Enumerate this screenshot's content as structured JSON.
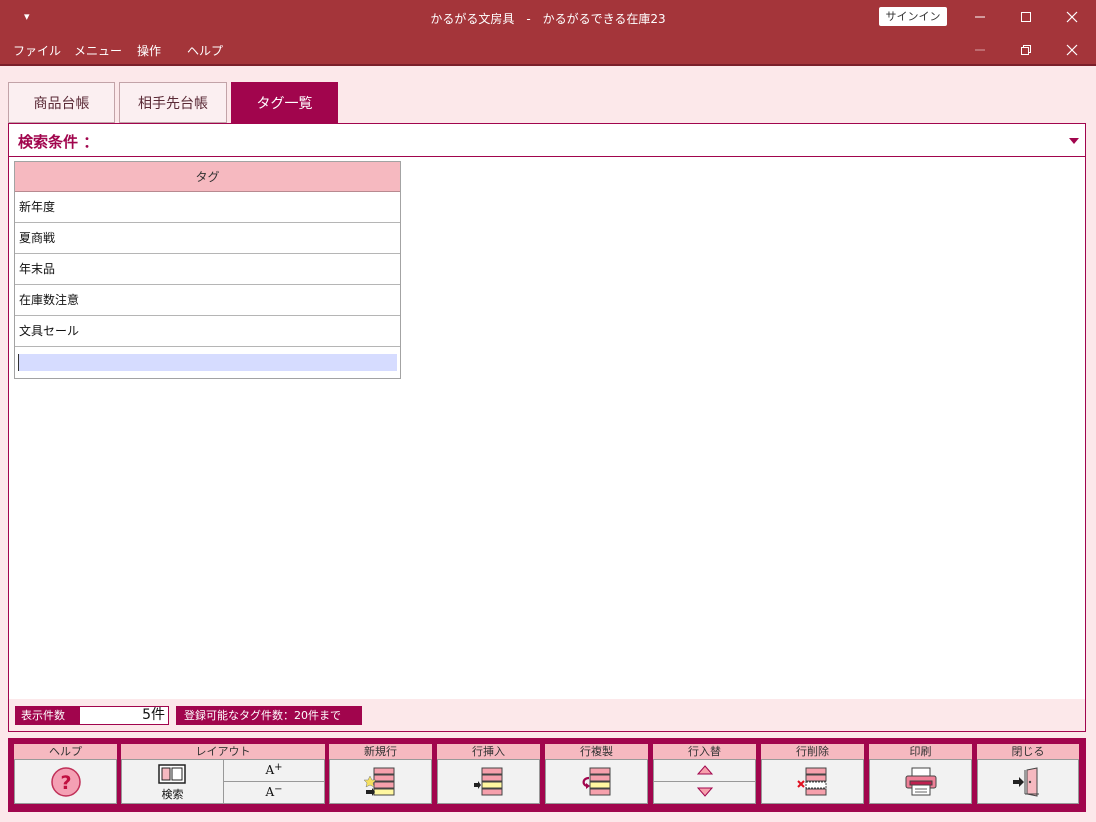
{
  "window": {
    "title": "かるがる文房具　-　かるがるできる在庫23",
    "quick_access": "▾",
    "signin": "サインイン"
  },
  "menu": {
    "items": [
      "ファイル",
      "メニュー",
      "操作",
      "ヘルプ"
    ]
  },
  "tabs": [
    {
      "label": "商品台帳",
      "active": false
    },
    {
      "label": "相手先台帳",
      "active": false
    },
    {
      "label": "タグ一覧",
      "active": true
    }
  ],
  "search": {
    "label": "検索条件 ："
  },
  "table": {
    "header": "タグ",
    "rows": [
      "新年度",
      "夏商戦",
      "年末品",
      "在庫数注意",
      "文具セール"
    ]
  },
  "status": {
    "count_label": "表示件数",
    "count_value": "5件",
    "note": "登録可能なタグ件数：20件まで"
  },
  "toolbar": {
    "help": "ヘルプ",
    "layout": "レイアウト",
    "layout_search": "検索",
    "font_up": "A",
    "font_up_sign": "+",
    "font_down": "A",
    "font_down_sign": "−",
    "new_row": "新規行",
    "insert_row": "行挿入",
    "copy_row": "行複製",
    "swap_row": "行入替",
    "delete_row": "行削除",
    "print": "印刷",
    "close": "閉じる"
  },
  "colors": {
    "titlebar": "#a4353a",
    "accent": "#a1054d",
    "header_pink": "#f6b9c0",
    "client_bg": "#fce8ea",
    "edit_row": "#d6dcff"
  }
}
